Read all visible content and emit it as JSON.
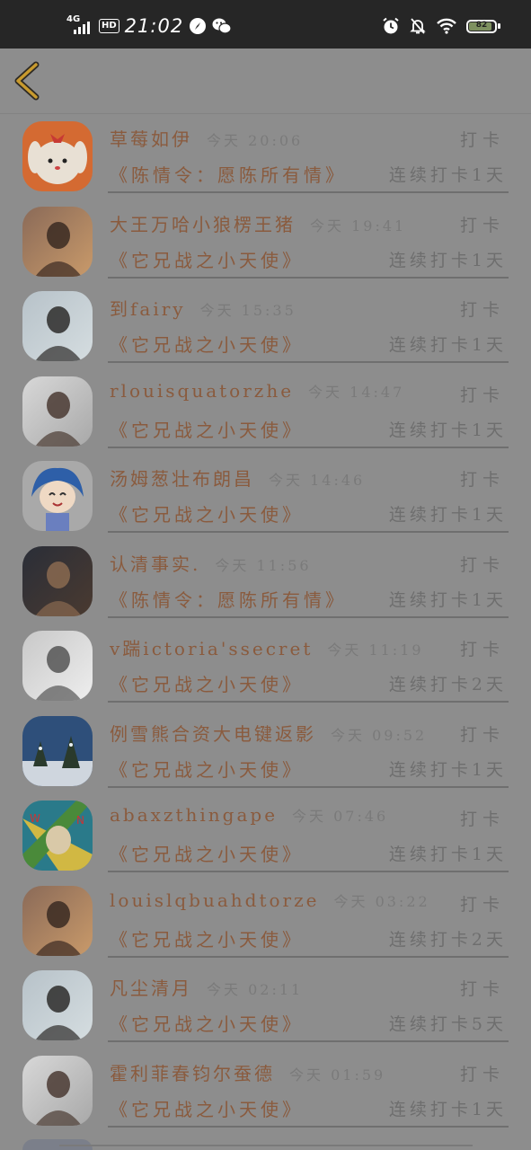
{
  "status_bar": {
    "network": "4G",
    "hd": "HD",
    "time": "21:02",
    "battery": "82",
    "battery_level": 0.82
  },
  "header": {
    "back_icon": "chevron-left-icon"
  },
  "colors": {
    "overlay_bg": "#8d8d8d",
    "name_color": "#8a5b3e",
    "muted_text": "#6e6e6e",
    "back_chevron": "#c89a2e"
  },
  "checkins": [
    {
      "name": "草莓如伊",
      "time": "今天 20:06",
      "action": "打卡",
      "book": "《陈情令：愿陈所有情》",
      "streak": "连续打卡1天",
      "avatar": "cartoon-dog-avatar"
    },
    {
      "name": "大王万哈小狼楞王猪",
      "time": "今天 19:41",
      "action": "打卡",
      "book": "《它兄战之小天使》",
      "streak": "连续打卡1天",
      "avatar": "photo-avatar"
    },
    {
      "name": "到fairy",
      "time": "今天 15:35",
      "action": "打卡",
      "book": "《它兄战之小天使》",
      "streak": "连续打卡1天",
      "avatar": "photo-avatar"
    },
    {
      "name": "rlouisquatorzhe",
      "time": "今天 14:47",
      "action": "打卡",
      "book": "《它兄战之小天使》",
      "streak": "连续打卡1天",
      "avatar": "photo-avatar"
    },
    {
      "name": "汤姆葱壮布朗昌",
      "time": "今天 14:46",
      "action": "打卡",
      "book": "《它兄战之小天使》",
      "streak": "连续打卡1天",
      "avatar": "anime-avatar"
    },
    {
      "name": "认清事实.",
      "time": "今天 11:56",
      "action": "打卡",
      "book": "《陈情令：愿陈所有情》",
      "streak": "连续打卡1天",
      "avatar": "photo-avatar"
    },
    {
      "name": "v踹ictoria'ssecret",
      "time": "今天 11:19",
      "action": "打卡",
      "book": "《它兄战之小天使》",
      "streak": "连续打卡2天",
      "avatar": "photo-avatar"
    },
    {
      "name": "例雪熊合资大电键返影",
      "time": "今天 09:52",
      "action": "打卡",
      "book": "《它兄战之小天使》",
      "streak": "连续打卡1天",
      "avatar": "snow-scene-avatar"
    },
    {
      "name": "abaxzthingape",
      "time": "今天 07:46",
      "action": "打卡",
      "book": "《它兄战之小天使》",
      "streak": "连续打卡1天",
      "avatar": "cartoon-avatar"
    },
    {
      "name": "louislqbuahdtorze",
      "time": "今天 03:22",
      "action": "打卡",
      "book": "《它兄战之小天使》",
      "streak": "连续打卡2天",
      "avatar": "photo-avatar"
    },
    {
      "name": "凡尘清月",
      "time": "今天 02:11",
      "action": "打卡",
      "book": "《它兄战之小天使》",
      "streak": "连续打卡5天",
      "avatar": "photo-avatar"
    },
    {
      "name": "霍利菲春钧尔蚕德",
      "time": "今天 01:59",
      "action": "打卡",
      "book": "《它兄战之小天使》",
      "streak": "连续打卡1天",
      "avatar": "photo-avatar"
    }
  ]
}
